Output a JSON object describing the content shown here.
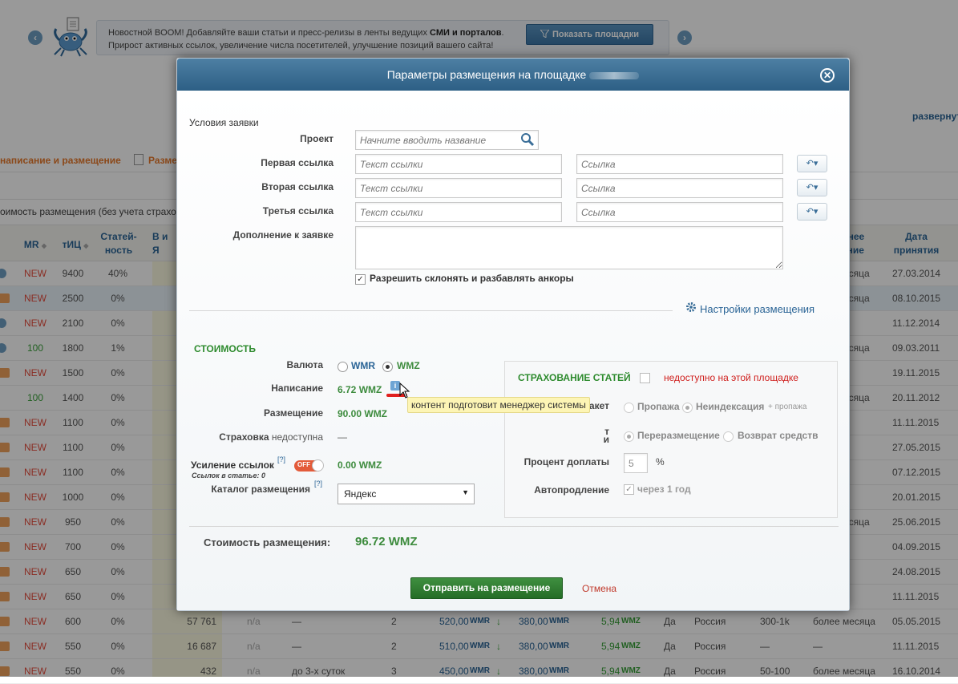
{
  "banner": {
    "text_line1_part1": "Новостной BOOM! Добавляйте ваши статьи и пресс-релизы в ленты ведущих ",
    "text_line1_bold": "СМИ и порталов",
    "text_line1_end": ".",
    "text_line2": "Прирост активных ссылок, увеличение числа посетителей, улучшение позиций вашего сайта!",
    "button_label": "Показать площадки",
    "prev_glyph": "‹",
    "next_glyph": "›"
  },
  "page": {
    "expand_link": "развернуть",
    "tab1": "написание и размещение",
    "tab2": "Разме",
    "subline": "оимость размещения (без учета страхо"
  },
  "table": {
    "headers": {
      "mr": "MR",
      "tic": "тИЦ",
      "articles": "Статей-\nность",
      "in_index": "В и\nЯ",
      "last": "днее\nение",
      "date": "Дата\nпринятия"
    },
    "rows": [
      {
        "mr": "NEW",
        "tic": "9400",
        "pct": "0%",
        "pct2": "40%",
        "last": "есяца",
        "date": "27.03.2014"
      },
      {
        "mr": "NEW",
        "tic": "2500",
        "pct": "0%",
        "last": "есяца",
        "date": "08.10.2015"
      },
      {
        "mr": "NEW",
        "tic": "2100",
        "pct": "0%",
        "last": "",
        "date": "11.12.2014"
      },
      {
        "mr": "100",
        "tic": "1800",
        "pct": "1%",
        "last": "есяца",
        "date": "09.03.2011"
      },
      {
        "mr": "NEW",
        "tic": "1500",
        "pct": "0%",
        "last": "",
        "date": "19.11.2015"
      },
      {
        "mr": "100",
        "tic": "1400",
        "pct": "0%",
        "last": "есяца",
        "date": "20.11.2012"
      },
      {
        "mr": "NEW",
        "tic": "1100",
        "pct": "0%",
        "last": "",
        "date": "11.11.2015"
      },
      {
        "mr": "NEW",
        "tic": "1100",
        "pct": "0%",
        "last": "",
        "date": "27.05.2015"
      },
      {
        "mr": "NEW",
        "tic": "1100",
        "pct": "0%",
        "last": "",
        "date": "07.12.2015"
      },
      {
        "mr": "NEW",
        "tic": "1000",
        "pct": "0%",
        "last": "",
        "date": "20.01.2015"
      },
      {
        "mr": "NEW",
        "tic": "950",
        "pct": "0%",
        "last": "есяца",
        "date": "25.06.2015"
      },
      {
        "mr": "NEW",
        "tic": "700",
        "pct": "0%",
        "last": "",
        "date": "04.09.2015"
      },
      {
        "mr": "NEW",
        "tic": "650",
        "pct": "0%",
        "last": "",
        "date": "24.08.2015"
      },
      {
        "mr": "NEW",
        "tic": "650",
        "pct": "0%",
        "last": "",
        "date": "11.11.2015"
      }
    ],
    "full_rows": [
      {
        "mr": "NEW",
        "tic": "600",
        "pct": "0%",
        "yandex": "57 761",
        "na": "n/a",
        "time": "—",
        "count": "2",
        "p1": "520,00",
        "p1u": "WMR",
        "p2": "380,00",
        "p2u": "WMR",
        "p3": "5,94",
        "p3u": "WMZ",
        "yes": "Да",
        "region": "Россия",
        "traffic": "300-1k",
        "last": "более месяца",
        "date": "05.05.2015"
      },
      {
        "mr": "NEW",
        "tic": "550",
        "pct": "0%",
        "yandex": "16 687",
        "na": "n/a",
        "time": "—",
        "count": "2",
        "p1": "510,00",
        "p1u": "WMR",
        "p2": "380,00",
        "p2u": "WMR",
        "p3": "5,94",
        "p3u": "WMZ",
        "yes": "Да",
        "region": "Россия",
        "traffic": "—",
        "last": "—",
        "date": "11.11.2015"
      },
      {
        "mr": "NEW",
        "tic": "550",
        "pct": "0%",
        "yandex": "432",
        "na": "n/a",
        "time": "до 3-х суток",
        "count": "3",
        "p1": "450,00",
        "p1u": "WMR",
        "p2": "380,00",
        "p2u": "WMR",
        "p3": "5,94",
        "p3u": "WMZ",
        "yes": "Да",
        "region": "Россия",
        "traffic": "50-100",
        "last": "более месяца",
        "date": "16.10.2014"
      }
    ],
    "down_arrow": "↓"
  },
  "modal": {
    "title": "Параметры размещения на площадке",
    "close_glyph": "✕",
    "conditions_label": "Условия заявки",
    "project_label": "Проект",
    "project_placeholder": "Начните вводить название",
    "link1_label": "Первая ссылка",
    "link2_label": "Вторая ссылка",
    "link3_label": "Третья ссылка",
    "anchor_placeholder": "Текст ссылки",
    "url_placeholder": "Ссылка",
    "undo_glyph": "↶▾",
    "addition_label": "Дополнение к заявке",
    "allow_anchors_label": "Разрешить склонять и разбавлять анкоры",
    "check_glyph": "✓",
    "settings_link": "Настройки размещения",
    "cost_section": "СТОИМОСТЬ",
    "currency_label": "Валюта",
    "wmr": "WMR",
    "wmz": "WMZ",
    "writing_label": "Написание",
    "writing_value": "6.72 WMZ",
    "placement_label": "Размещение",
    "placement_value": "90.00 WMZ",
    "insurance_label": "Страховка",
    "insurance_status": "недоступна",
    "insurance_dash": "—",
    "boost_label": "Усиление ссылок",
    "boost_help": "[?]",
    "toggle_label": "OFF",
    "links_in_article": "Ссылок в статье: 0",
    "boost_value": "0.00 WMZ",
    "catalog_label": "Каталог размещения",
    "catalog_help": "[?]",
    "catalog_value": "Яндекс",
    "catalog_arrow": "▼",
    "tooltip": "контент подготовит менеджер системы",
    "insurance_section": "СТРАХОВАНИЕ СТАТЕЙ",
    "insurance_unavailable": "недоступно на этой площадке",
    "package_label": "Пакет",
    "package_loss": "Пропажа",
    "package_noindex": "Неиндексация",
    "package_plus": "+ пропажа",
    "option_label_a": "т",
    "option_label_b": "и",
    "option_replace": "Переразмещение",
    "option_refund": "Возврат средств",
    "surcharge_label": "Процент доплаты",
    "surcharge_value": "5",
    "percent_sign": "%",
    "autorenew_label": "Автопродление",
    "autorenew_value": "через 1 год",
    "total_label": "Стоимость размещения:",
    "total_value": "96.72 WMZ",
    "submit_label": "Отправить на размещение",
    "cancel_label": "Отмена"
  },
  "colors": {
    "accent_blue": "#2a6496",
    "header_blue": "#3d6f94",
    "submit_green": "#2e7d32",
    "value_green": "#3d8b3d",
    "new_red": "#e74c3c",
    "tooltip_yellow": "#fdf5b5"
  },
  "icons": [
    "chevron-left-icon",
    "chevron-right-icon",
    "crab-mascot-icon",
    "filter-icon",
    "search-icon",
    "gear-icon",
    "undo-icon",
    "close-icon",
    "info-icon",
    "doc-icon"
  ]
}
